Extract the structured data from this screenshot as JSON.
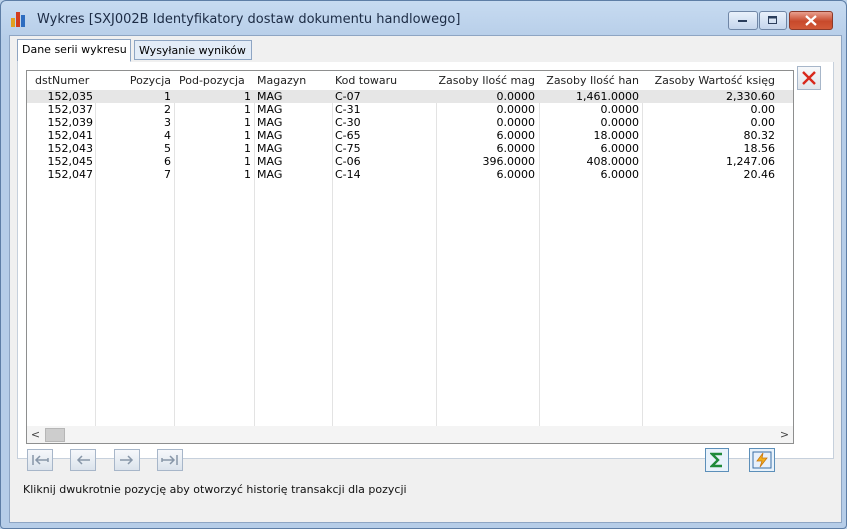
{
  "window": {
    "title": "Wykres [SXJ002B Identyfikatory dostaw dokumentu handlowego]"
  },
  "tabs": [
    {
      "label": "Dane serii wykresu",
      "active": true
    },
    {
      "label": "Wysyłanie wyników",
      "active": false
    }
  ],
  "grid": {
    "columns": [
      "dstNumer",
      "Pozycja",
      "Pod-pozycja",
      "Magazyn",
      "Kod towaru",
      "Zasoby Ilość mag",
      "Zasoby Ilość han",
      "Zasoby Wartość księg"
    ],
    "rows": [
      [
        "152,035",
        "1",
        "1",
        "MAG",
        "C-07",
        "0.0000",
        "1,461.0000",
        "2,330.60"
      ],
      [
        "152,037",
        "2",
        "1",
        "MAG",
        "C-31",
        "0.0000",
        "0.0000",
        "0.00"
      ],
      [
        "152,039",
        "3",
        "1",
        "MAG",
        "C-30",
        "0.0000",
        "0.0000",
        "0.00"
      ],
      [
        "152,041",
        "4",
        "1",
        "MAG",
        "C-65",
        "6.0000",
        "18.0000",
        "80.32"
      ],
      [
        "152,043",
        "5",
        "1",
        "MAG",
        "C-75",
        "6.0000",
        "6.0000",
        "18.56"
      ],
      [
        "152,045",
        "6",
        "1",
        "MAG",
        "C-06",
        "396.0000",
        "408.0000",
        "1,247.06"
      ],
      [
        "152,047",
        "7",
        "1",
        "MAG",
        "C-14",
        "6.0000",
        "6.0000",
        "20.46"
      ]
    ],
    "selected_row": 0
  },
  "scrollbar": {
    "left_arrow": "<",
    "right_arrow": ">"
  },
  "nav": {
    "first_icon": "first-record-icon",
    "prev_icon": "previous-record-icon",
    "next_icon": "next-record-icon",
    "last_icon": "last-record-icon"
  },
  "tools": {
    "sum_icon": "sigma-icon",
    "export_icon": "lightning-export-icon",
    "close_icon": "red-x-icon"
  },
  "status_text": "Kliknij dwukrotnie pozycję aby otworzyć historię transakcji dla pozycji",
  "colors": {
    "close_red": "#d8281c",
    "sigma_green": "#1f8a3a",
    "selected_row": "#e6e6e6"
  }
}
